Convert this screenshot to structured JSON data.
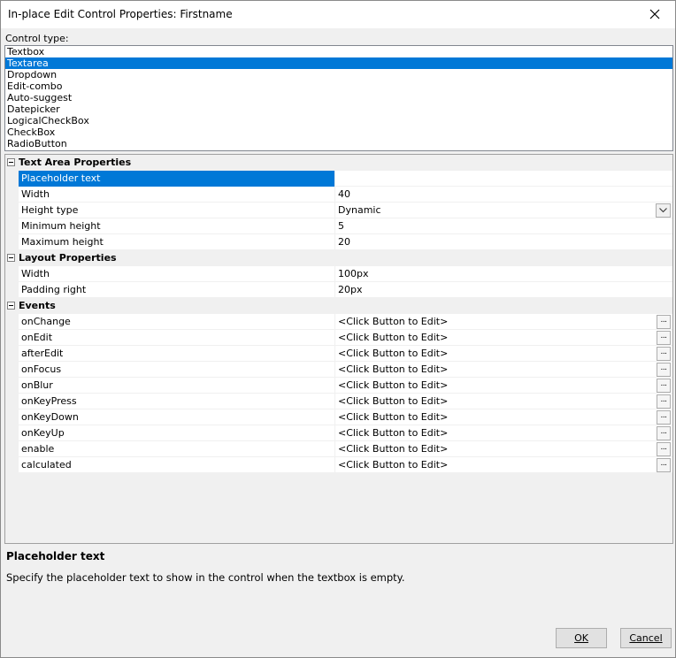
{
  "window": {
    "title": "In-place Edit Control Properties: Firstname"
  },
  "control_type": {
    "label": "Control type:",
    "options": [
      "Textbox",
      "Textarea",
      "Dropdown",
      "Edit-combo",
      "Auto-suggest",
      "Datepicker",
      "LogicalCheckBox",
      "CheckBox",
      "RadioButton"
    ],
    "selected": "Textarea"
  },
  "grid": {
    "categories": [
      {
        "name": "Text Area Properties",
        "props": [
          {
            "name": "Placeholder text",
            "value": ""
          },
          {
            "name": "Width",
            "value": "40"
          },
          {
            "name": "Height type",
            "value": "Dynamic"
          },
          {
            "name": "Minimum height",
            "value": "5"
          },
          {
            "name": "Maximum height",
            "value": "20"
          }
        ]
      },
      {
        "name": "Layout Properties",
        "props": [
          {
            "name": "Width",
            "value": "100px"
          },
          {
            "name": "Padding right",
            "value": "20px"
          }
        ]
      },
      {
        "name": "Events",
        "props": [
          {
            "name": "onChange",
            "value": "<Click Button to Edit>"
          },
          {
            "name": "onEdit",
            "value": "<Click Button to Edit>"
          },
          {
            "name": "afterEdit",
            "value": "<Click Button to Edit>"
          },
          {
            "name": "onFocus",
            "value": "<Click Button to Edit>"
          },
          {
            "name": "onBlur",
            "value": "<Click Button to Edit>"
          },
          {
            "name": "onKeyPress",
            "value": "<Click Button to Edit>"
          },
          {
            "name": "onKeyDown",
            "value": "<Click Button to Edit>"
          },
          {
            "name": "onKeyUp",
            "value": "<Click Button to Edit>"
          },
          {
            "name": "enable",
            "value": "<Click Button to Edit>"
          },
          {
            "name": "calculated",
            "value": "<Click Button to Edit>"
          }
        ]
      }
    ],
    "ellipsis_label": "..."
  },
  "help": {
    "title": "Placeholder text",
    "description": "Specify the placeholder text to show in the control when the textbox is empty."
  },
  "buttons": {
    "ok": "OK",
    "cancel": "Cancel"
  },
  "colors": {
    "selection": "#0078d7",
    "background": "#f0f0f0"
  }
}
